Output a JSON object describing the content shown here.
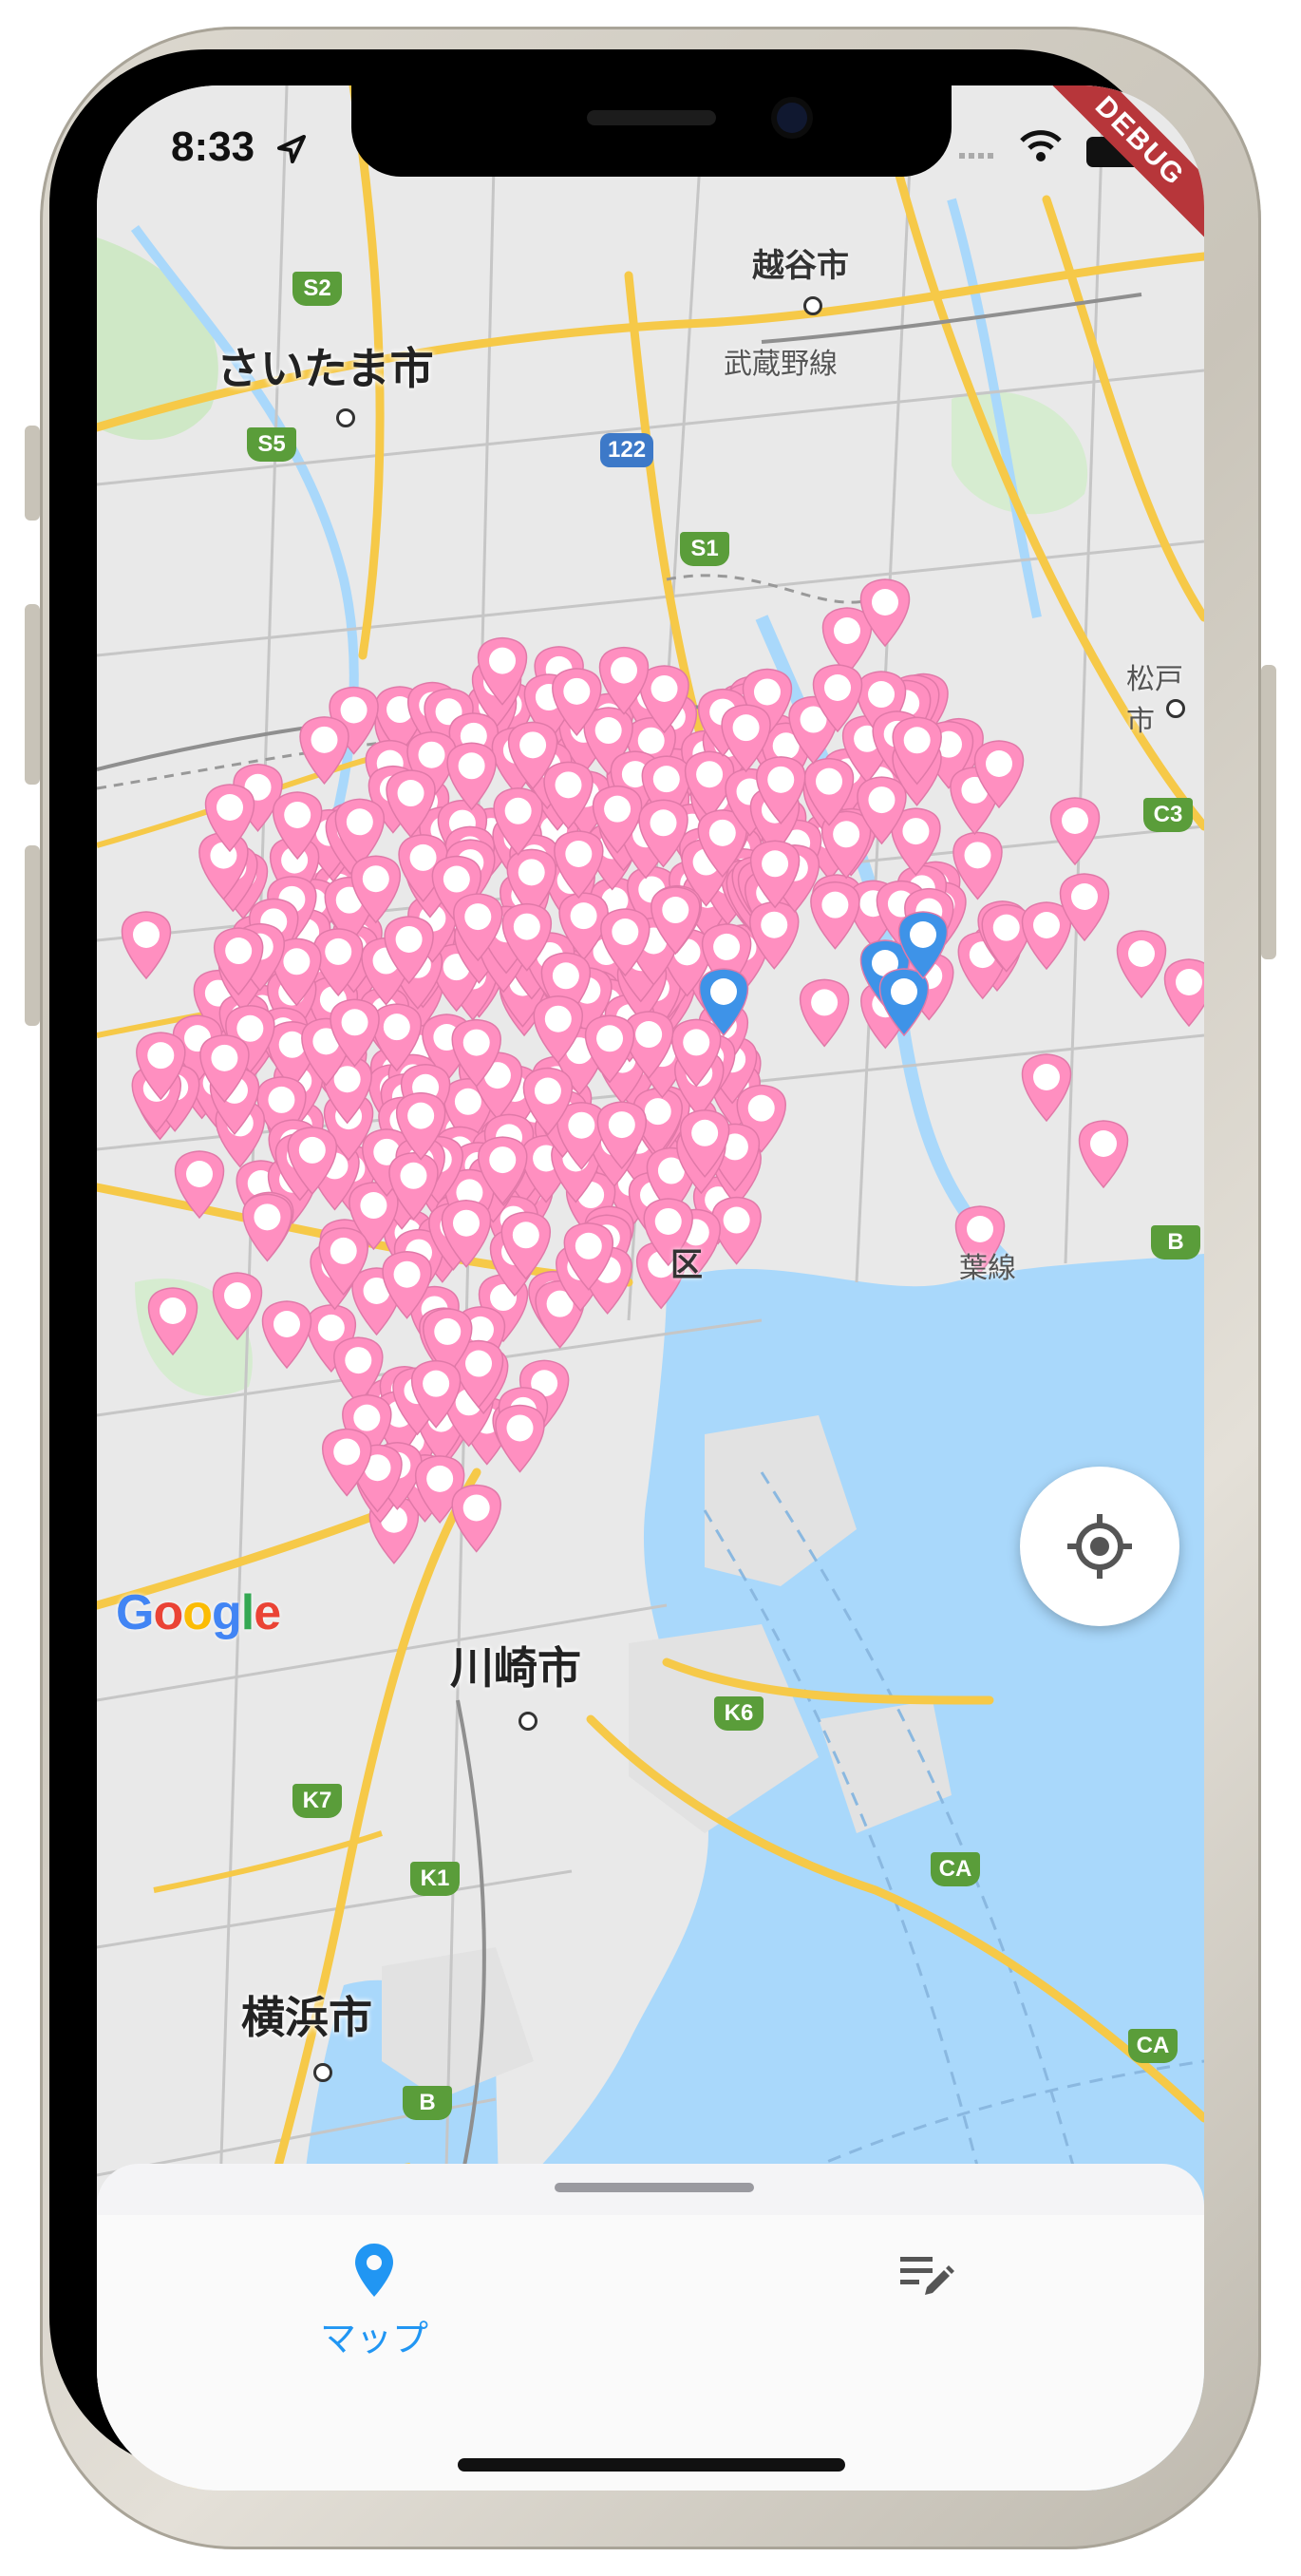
{
  "status_bar": {
    "time": "8:33",
    "debug_banner": "DEBUG"
  },
  "map": {
    "cities": [
      {
        "name": "さいたま市"
      },
      {
        "name": "越谷市"
      },
      {
        "name": "川崎市"
      },
      {
        "name": "横浜市"
      },
      {
        "name": "松戸市"
      }
    ],
    "place_labels": [
      "区",
      "葉線"
    ],
    "line_labels": [
      "武蔵野線"
    ],
    "route_shields": [
      "S2",
      "S5",
      "122",
      "S1",
      "C3",
      "B",
      "K6",
      "K7",
      "K1",
      "CA",
      "CA",
      "B"
    ],
    "attribution": "Google",
    "marker_colors": {
      "pink": "#ff8fc0",
      "blue": "#3e93e8"
    },
    "water_color": "#a9d8fb"
  },
  "controls": {
    "my_location_icon": "my-location-icon"
  },
  "bottom_nav": {
    "items": [
      {
        "label": "マップ",
        "icon": "map-pin-icon",
        "selected": true
      },
      {
        "label": "",
        "icon": "edit-list-icon",
        "selected": false
      }
    ],
    "accent_color": "#2196f3"
  }
}
